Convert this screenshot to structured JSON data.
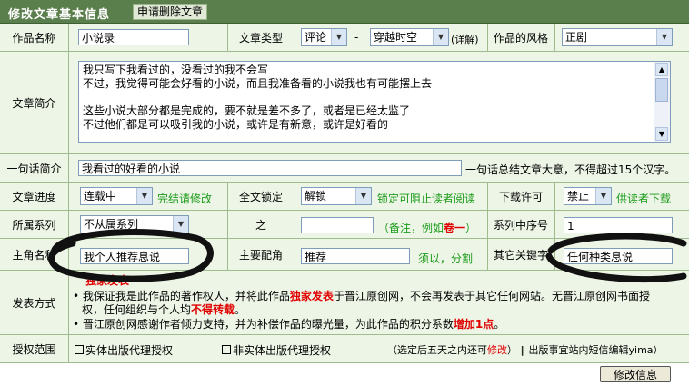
{
  "header": {
    "title": "修改文章基本信息",
    "delete_link": "申请删除文章"
  },
  "labels": {
    "work_name": "作品名称",
    "article_type": "文章类型",
    "style": "作品的风格",
    "summary": "文章简介",
    "one_line": "一句话简介",
    "progress": "文章进度",
    "full_lock": "全文锁定",
    "download": "下载许可",
    "series": "所属系列",
    "zhi": "之",
    "series_no": "系列中序号",
    "protagonist": "主角名称",
    "supporting": "主要配角",
    "keywords": "其它关键字",
    "publish": "发表方式",
    "license": "授权范围"
  },
  "fields": {
    "work_name": "小说录",
    "type_1": "评论",
    "type_sep": "-",
    "type_2": "穿越时空",
    "detail_link": "(详解)",
    "style": "正剧",
    "summary_lines": [
      "我只写下我看过的，没看过的我不会写",
      "不过，我觉得可能会好看的小说，而且我准备看的小说我也有可能摆上去",
      "",
      "这些小说大部分都是完成的，要不就是差不多了，或者是已经太监了",
      "不过他们都是可以吸引我的小说，或许是有新意，或许是好看的"
    ],
    "one_line": "我看过的好看的小说",
    "one_line_note": "一句话总结文章大意，不得超过15个汉字。",
    "progress": "连载中",
    "progress_note": "完结请修改",
    "lock": "解锁",
    "lock_note": "锁定可阻止读者阅读",
    "download": "禁止",
    "download_note": "供读者下载",
    "series": "不从属系列",
    "zhi_value": "",
    "zhi_note_prefix": "（备注，例如",
    "zhi_note_red": "卷一",
    "zhi_note_suffix": "）",
    "series_no": "1",
    "protagonist": "我个人推荐息说",
    "supporting": "推荐",
    "supporting_note": "须以，分割",
    "keywords": "任何种类息说"
  },
  "publish": {
    "red_note": "独家发表",
    "b1_a": "我保证我是此作品的著作权人，并将此作品",
    "b1_red": "独家发表",
    "b1_b": "于晋江原创网，不会再发表于其它任何网站。无晋江原创网书面授",
    "b1_c": "权，任何组织与个人均",
    "b1_red2": "不得转载",
    "b1_d": "。",
    "b2_a": "晋江原创网感谢作者倾力支持，并为补偿作品的曝光量，为此作品的积分系数",
    "b2_red": "增加1点",
    "b2_b": "。"
  },
  "license": {
    "opt1": "实体出版代理授权",
    "opt2": "非实体出版代理授权",
    "note_a": "（选定后五天之内还可",
    "note_red": "修改",
    "note_b": "）",
    "note_c": "出版事宜站内短信编辑yima）"
  },
  "submit": "修改信息",
  "colors": {
    "header": "#5a7e4c",
    "row_bg": "#edf5e6",
    "border": "#9ebc8c",
    "green_note": "#1a9b1a",
    "red": "#e00000"
  }
}
